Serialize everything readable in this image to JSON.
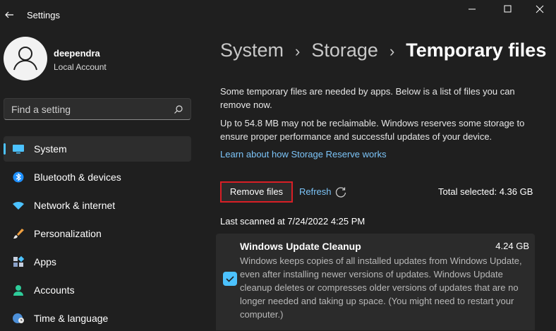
{
  "window": {
    "title": "Settings"
  },
  "profile": {
    "name": "deependra",
    "account_type": "Local Account"
  },
  "search": {
    "placeholder": "Find a setting"
  },
  "nav": {
    "items": [
      {
        "label": "System",
        "icon": "monitor-icon",
        "active": true
      },
      {
        "label": "Bluetooth & devices",
        "icon": "bluetooth-icon"
      },
      {
        "label": "Network & internet",
        "icon": "wifi-icon"
      },
      {
        "label": "Personalization",
        "icon": "brush-icon"
      },
      {
        "label": "Apps",
        "icon": "apps-icon"
      },
      {
        "label": "Accounts",
        "icon": "person-icon"
      },
      {
        "label": "Time & language",
        "icon": "globe-clock-icon"
      }
    ]
  },
  "breadcrumb": {
    "items": [
      "System",
      "Storage"
    ],
    "current": "Temporary files"
  },
  "content": {
    "intro": "Some temporary files are needed by apps. Below is a list of files you can remove now.",
    "reserve_note": "Up to 54.8 MB may not be reclaimable. Windows reserves some storage to ensure proper performance and successful updates of your device.",
    "reserve_link": "Learn about how Storage Reserve works",
    "remove_label": "Remove files",
    "refresh_label": "Refresh",
    "total_selected": "Total selected: 4.36 GB",
    "last_scanned": "Last scanned at 7/24/2022 4:25 PM"
  },
  "items": [
    {
      "title": "Windows Update Cleanup",
      "size": "4.24 GB",
      "checked": true,
      "description": "Windows keeps copies of all installed updates from Windows Update, even after installing newer versions of updates. Windows Update cleanup deletes or compresses older versions of updates that are no longer needed and taking up space. (You might need to restart your computer.)"
    }
  ],
  "colors": {
    "accent": "#4cc2ff",
    "link": "#7cc4f8",
    "highlight_border": "#d81f26",
    "background": "#1f1f1f"
  }
}
